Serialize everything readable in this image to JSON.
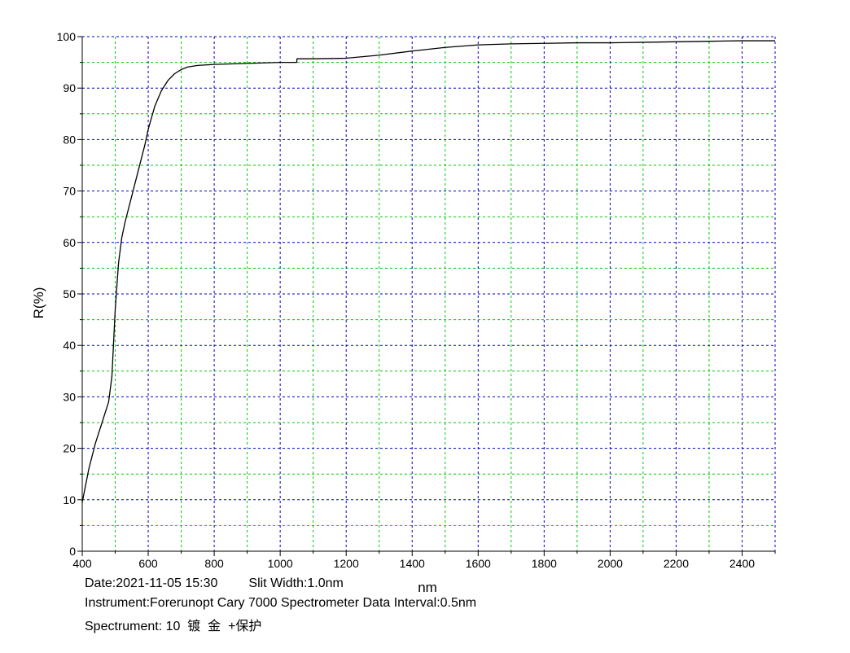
{
  "chart_data": {
    "type": "line",
    "xlabel": "nm",
    "ylabel": "R(%)",
    "xlim": [
      400,
      2500
    ],
    "ylim": [
      0,
      100
    ],
    "x_ticks": [
      400,
      600,
      800,
      1000,
      1200,
      1400,
      1600,
      1800,
      2000,
      2200,
      2400
    ],
    "y_ticks": [
      0,
      10,
      20,
      30,
      40,
      50,
      60,
      70,
      80,
      90,
      100
    ],
    "grid": true,
    "series": [
      {
        "color": "#000000",
        "x": [
          400,
          420,
          440,
          460,
          480,
          490,
          500,
          510,
          520,
          530,
          550,
          570,
          590,
          600,
          620,
          640,
          660,
          680,
          700,
          720,
          750,
          800,
          850,
          900,
          1000,
          1050,
          1051,
          1100,
          1200,
          1300,
          1400,
          1500,
          1600,
          1700,
          1800,
          1900,
          2000,
          2100,
          2200,
          2300,
          2400,
          2500
        ],
        "y": [
          9.5,
          16,
          21,
          25,
          29,
          34,
          47,
          56,
          61,
          64,
          69,
          74,
          79,
          82,
          86.5,
          89.5,
          91.5,
          92.8,
          93.6,
          94.1,
          94.4,
          94.6,
          94.7,
          94.8,
          95.0,
          95.0,
          95.7,
          95.7,
          95.8,
          96.4,
          97.2,
          97.9,
          98.4,
          98.6,
          98.7,
          98.8,
          98.8,
          98.9,
          99.0,
          99.1,
          99.2,
          99.2
        ]
      }
    ]
  },
  "footer": {
    "line1_date": "Date:2021-11-05 15:30",
    "line1_slit": "Slit Width:1.0nm",
    "line2": "Instrument:Forerunopt Cary 7000 Spectrometer Data Interval:0.5nm",
    "line3": "Spectrument: 10  镀  金  +保护"
  },
  "colors": {
    "major_grid": "#0000c8",
    "minor_grid": "#00c800",
    "curve": "#000000"
  }
}
